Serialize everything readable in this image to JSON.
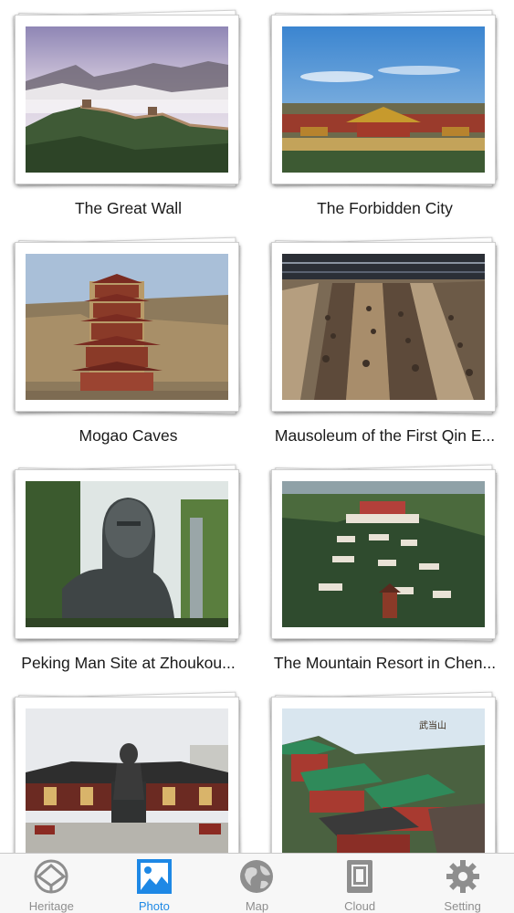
{
  "gallery": {
    "items": [
      {
        "caption": "The Great Wall"
      },
      {
        "caption": "The Forbidden City"
      },
      {
        "caption": "Mogao Caves"
      },
      {
        "caption": "Mausoleum of the First Qin E..."
      },
      {
        "caption": "Peking Man Site at Zhoukou..."
      },
      {
        "caption": "The Mountain Resort in Chen..."
      },
      {
        "caption": ""
      },
      {
        "caption": ""
      }
    ],
    "photo_watermark": "武当山"
  },
  "tabbar": {
    "active": "Photo",
    "accent": "#1e88e5",
    "inactive_color": "#8e8e8e",
    "tabs": [
      {
        "label": "Heritage",
        "icon": "heritage-icon"
      },
      {
        "label": "Photo",
        "icon": "photo-icon"
      },
      {
        "label": "Map",
        "icon": "globe-icon"
      },
      {
        "label": "Cloud",
        "icon": "cloud-icon"
      },
      {
        "label": "Setting",
        "icon": "gear-icon"
      }
    ]
  }
}
